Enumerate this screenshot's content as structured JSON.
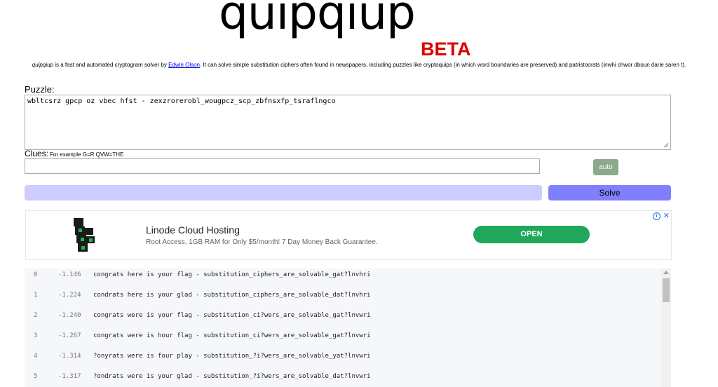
{
  "header": {
    "logo_text": "quipqiup",
    "beta_text": "BETA",
    "intro_name": "quipqiup",
    "intro_middle": " is a fast and automated cryptogram solver by ",
    "author_link": "Edwin Olson",
    "intro_rest": ". It can solve simple substitution ciphers often found in newspapers, including puzzles like cryptoquips (in which word boundaries are preserved) and patristocrats (inwhi chwor dboun darie saren t)."
  },
  "puzzle": {
    "label": "Puzzle:",
    "value": "wbltcsrz gpcp oz vbec hfst - zexzrorerobl_wougpcz_scp_zbfnsxfp_tsraflngco"
  },
  "clues": {
    "label": "Clues:",
    "hint": "For example G=R QVW=THE",
    "value": ""
  },
  "buttons": {
    "auto": "auto",
    "solve": "Solve"
  },
  "ad": {
    "title": "Linode Cloud Hosting",
    "subtitle": "Root Access, 1GB RAM for Only $5/month! 7 Day Money Back Guarantee.",
    "cta": "OPEN",
    "info_glyph": "i",
    "close_glyph": "✕",
    "icons": [
      "linode-cube-logo-icon",
      "ad-info-icon",
      "ad-close-icon"
    ]
  },
  "results": [
    {
      "index": "0",
      "score": "-1.146",
      "text": "congrats here is your flag - substitution_ciphers_are_solvable_gat?lnvhri"
    },
    {
      "index": "1",
      "score": "-1.224",
      "text": "condrats here is your glad - substitution_ciphers_are_solvable_dat?lnvhri"
    },
    {
      "index": "2",
      "score": "-1.240",
      "text": "congrats were is your flag - substitution_ci?wers_are_solvable_gat?lnvwri"
    },
    {
      "index": "3",
      "score": "-1.267",
      "text": "congrats were is hour flag - substitution_ci?wers_are_solvable_gat?lnvwri"
    },
    {
      "index": "4",
      "score": "-1.314",
      "text": "?onyrats were is four play - substitution_?i?wers_are_solvable_yat?lnvwri"
    },
    {
      "index": "5",
      "score": "-1.317",
      "text": "?ondrats were is your glad - substitution_?i?wers_are_solvable_dat?lnvwri"
    }
  ],
  "colors": {
    "beta": "#dd0000",
    "solve_button": "#8080ff",
    "progress_bar": "#ccccff",
    "auto_button": "#8aaa8a",
    "ad_cta": "#1fa85a",
    "link": "#0000ee"
  }
}
